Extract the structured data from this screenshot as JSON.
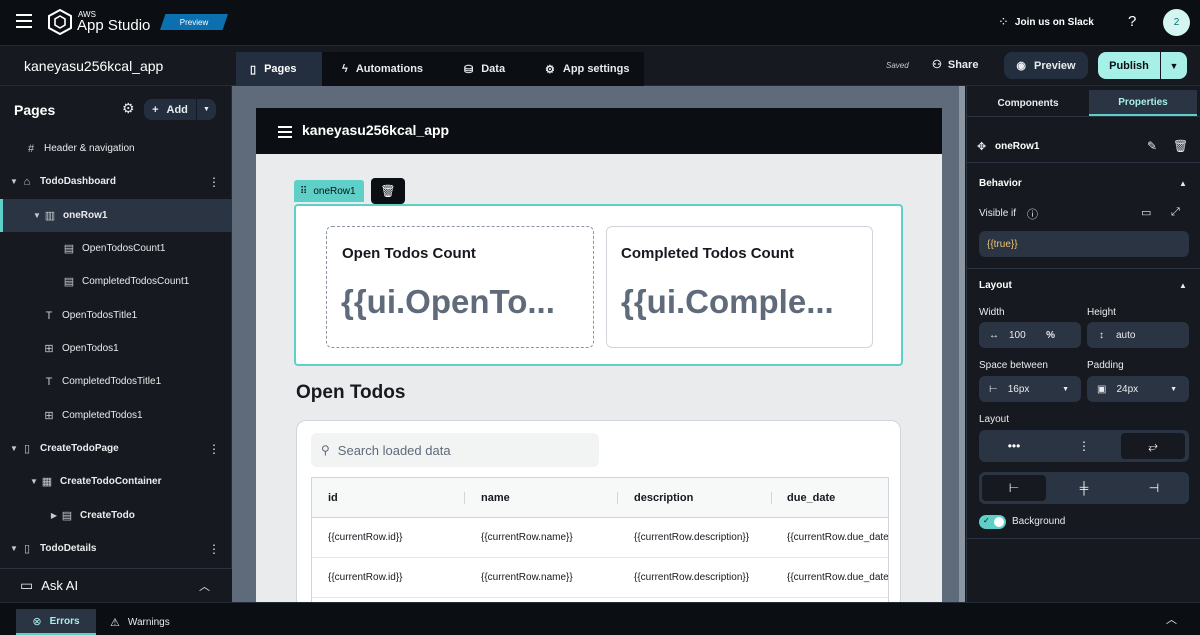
{
  "header": {
    "logo_small": "AWS",
    "logo": "App Studio",
    "badge": "Preview",
    "slack": "Join us on Slack",
    "help": "?",
    "avatar": "2"
  },
  "subbar": {
    "app_name": "kaneyasu256kcal_app",
    "tabs": [
      "Pages",
      "Automations",
      "Data",
      "App settings"
    ],
    "saved": "Saved",
    "share": "Share",
    "preview": "Preview",
    "publish": "Publish"
  },
  "sidebar": {
    "title": "Pages",
    "add": "Add",
    "items": [
      "Header & navigation",
      "TodoDashboard",
      "oneRow1",
      "OpenTodosCount1",
      "CompletedTodosCount1",
      "OpenTodosTitle1",
      "OpenTodos1",
      "CompletedTodosTitle1",
      "CompletedTodos1",
      "CreateTodoPage",
      "CreateTodoContainer",
      "CreateTodo",
      "TodoDetails"
    ],
    "ask_ai": "Ask AI"
  },
  "canvas": {
    "app_title": "kaneyasu256kcal_app",
    "selected_label": "oneRow1",
    "card1_title": "Open Todos Count",
    "card1_value": "{{ui.OpenTo...",
    "card2_title": "Completed Todos Count",
    "card2_value": "{{ui.Comple...",
    "section_title": "Open Todos",
    "search_placeholder": "Search loaded data",
    "columns": [
      "id",
      "name",
      "description",
      "due_date"
    ],
    "rows": [
      [
        "{{currentRow.id}}",
        "{{currentRow.name}}",
        "{{currentRow.description}}",
        "{{currentRow.due_date"
      ],
      [
        "{{currentRow.id}}",
        "{{currentRow.name}}",
        "{{currentRow.description}}",
        "{{currentRow.due_date"
      ]
    ]
  },
  "right_panel": {
    "tabs": [
      "Components",
      "Properties"
    ],
    "component_name": "oneRow1",
    "behavior": "Behavior",
    "visible_if": "Visible if",
    "visible_value": "{{true}}",
    "layout_section": "Layout",
    "width_label": "Width",
    "width_value": "100",
    "width_unit": "%",
    "height_label": "Height",
    "height_value": "auto",
    "space_label": "Space between",
    "space_value": "16px",
    "padding_label": "Padding",
    "padding_value": "24px",
    "layout_label": "Layout",
    "background": "Background"
  },
  "bottom": {
    "errors": "Errors",
    "warnings": "Warnings"
  },
  "colors": {
    "accent": "#5fd0c8",
    "brand_badge": "#0972d3"
  }
}
